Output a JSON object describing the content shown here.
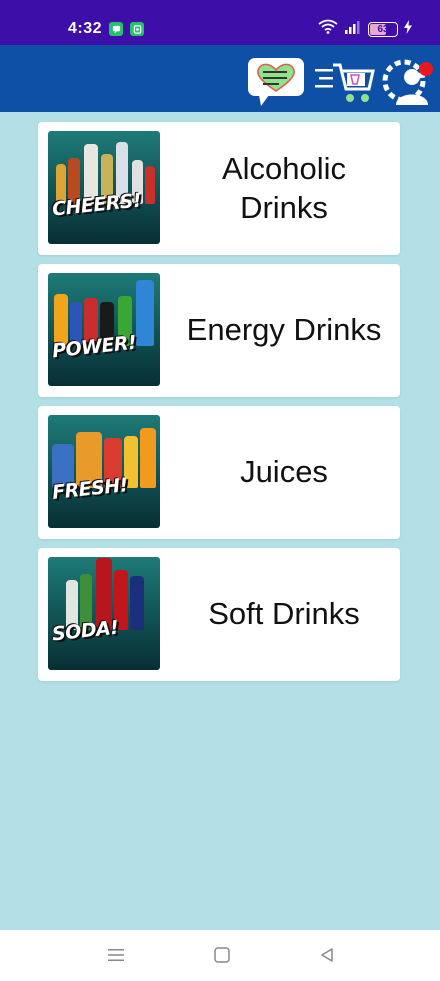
{
  "status_bar": {
    "time": "4:32",
    "battery_level": 63,
    "battery_text": "63",
    "icons": [
      "chat-notification-icon",
      "app-notification-icon",
      "wifi-icon",
      "signal-icon",
      "battery-icon",
      "charging-icon"
    ]
  },
  "app_bar": {
    "icons": [
      "chat-bubble-icon",
      "cart-icon",
      "account-settings-icon"
    ],
    "colors": {
      "background": "#0d50a5",
      "status_background": "#3d0ea8"
    }
  },
  "categories": [
    {
      "label": "Alcoholic Drinks",
      "thumb_text": "CHEERS!",
      "icon": "alcoholic-drinks-image"
    },
    {
      "label": "Energy Drinks",
      "thumb_text": "POWER!",
      "icon": "energy-drinks-image"
    },
    {
      "label": "Juices",
      "thumb_text": "FRESH!",
      "icon": "juices-image"
    },
    {
      "label": "Soft Drinks",
      "thumb_text": "SODA!",
      "icon": "soft-drinks-image"
    }
  ],
  "nav_bar": {
    "icons": [
      "menu-icon",
      "home-icon",
      "back-icon"
    ]
  },
  "colors": {
    "page_background": "#b2e0e6",
    "card_background": "#ffffff"
  }
}
